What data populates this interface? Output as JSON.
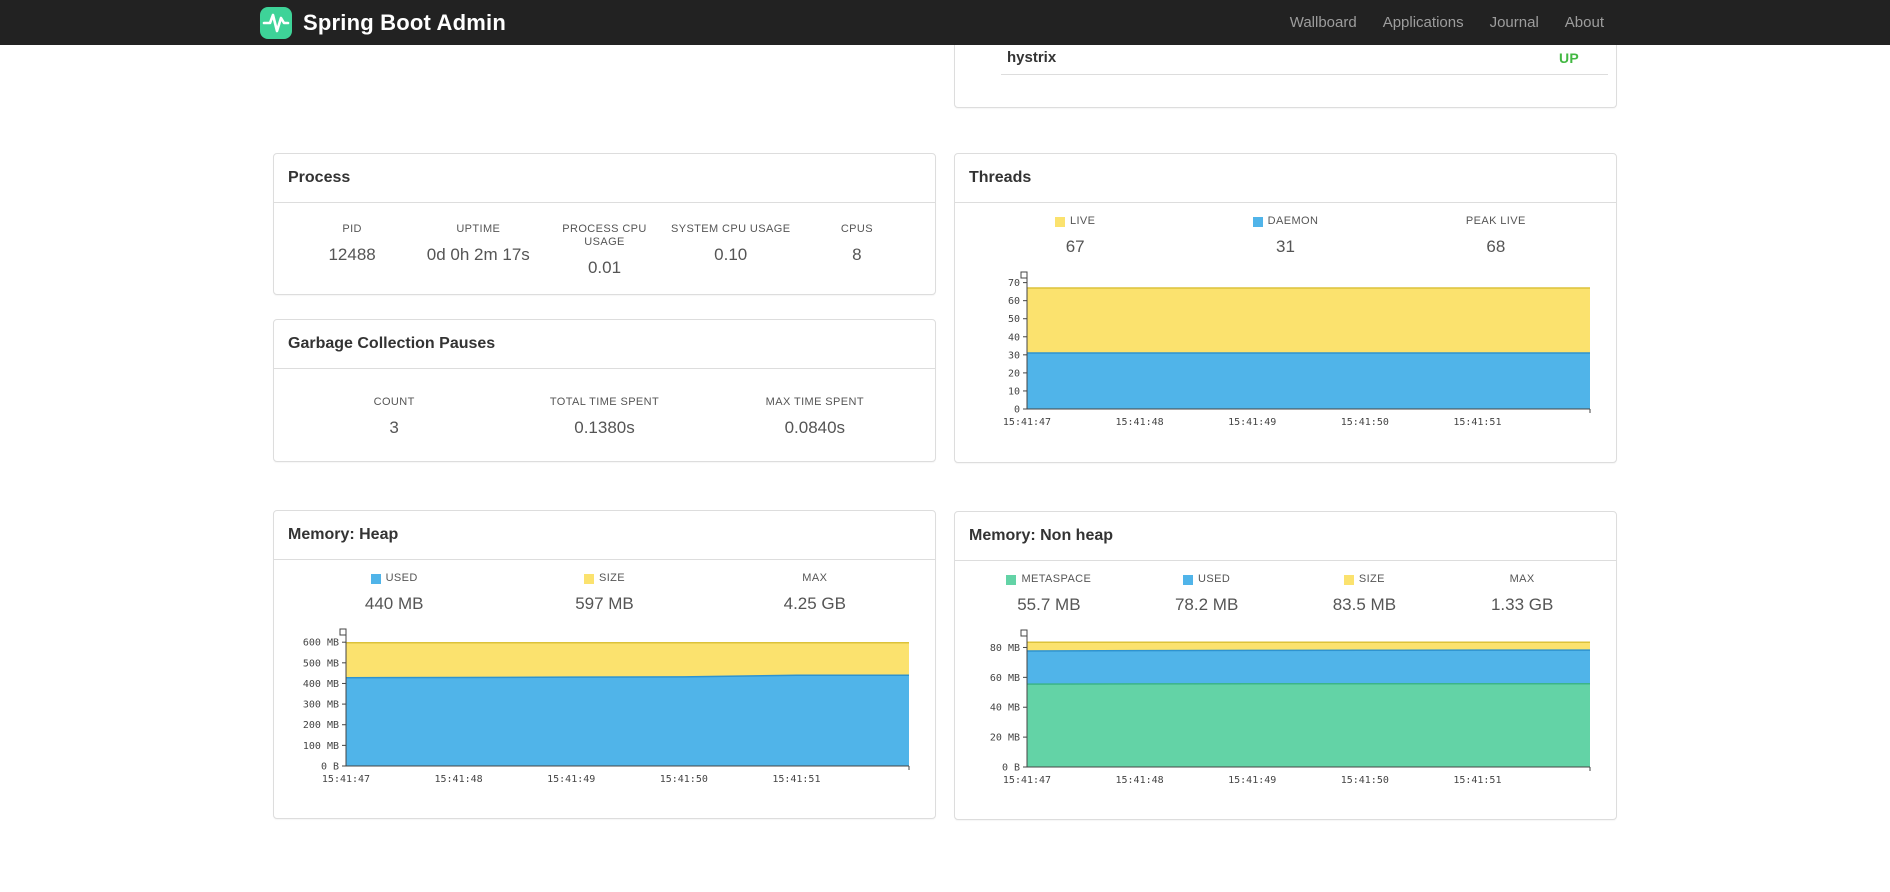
{
  "navbar": {
    "brand": "Spring Boot Admin",
    "links": [
      "Wallboard",
      "Applications",
      "Journal",
      "About"
    ]
  },
  "colors": {
    "blue": "#50b4e9",
    "yellow": "#fbe26e",
    "green": "#63d3a6",
    "status_up": "#43b843",
    "logo": "#3ed398"
  },
  "health": {
    "name": "hystrix",
    "status": "UP"
  },
  "panels": {
    "process": {
      "title": "Process",
      "stats": [
        {
          "label": "PID",
          "value": "12488"
        },
        {
          "label": "UPTIME",
          "value": "0d 0h 2m 17s"
        },
        {
          "label": "PROCESS CPU USAGE",
          "value": "0.01"
        },
        {
          "label": "SYSTEM CPU USAGE",
          "value": "0.10"
        },
        {
          "label": "CPUS",
          "value": "8"
        }
      ]
    },
    "gc": {
      "title": "Garbage Collection Pauses",
      "stats": [
        {
          "label": "COUNT",
          "value": "3"
        },
        {
          "label": "TOTAL TIME SPENT",
          "value": "0.1380s"
        },
        {
          "label": "MAX TIME SPENT",
          "value": "0.0840s"
        }
      ]
    },
    "threads": {
      "title": "Threads",
      "stats": [
        {
          "label": "LIVE",
          "value": "67",
          "swatch": "#fbe26e"
        },
        {
          "label": "DAEMON",
          "value": "31",
          "swatch": "#50b4e9"
        },
        {
          "label": "PEAK LIVE",
          "value": "68"
        }
      ]
    },
    "heap": {
      "title": "Memory: Heap",
      "stats": [
        {
          "label": "USED",
          "value": "440 MB",
          "swatch": "#50b4e9"
        },
        {
          "label": "SIZE",
          "value": "597 MB",
          "swatch": "#fbe26e"
        },
        {
          "label": "MAX",
          "value": "4.25 GB"
        }
      ]
    },
    "nonheap": {
      "title": "Memory: Non heap",
      "stats": [
        {
          "label": "METASPACE",
          "value": "55.7 MB",
          "swatch": "#63d3a6"
        },
        {
          "label": "USED",
          "value": "78.2 MB",
          "swatch": "#50b4e9"
        },
        {
          "label": "SIZE",
          "value": "83.5 MB",
          "swatch": "#fbe26e"
        },
        {
          "label": "MAX",
          "value": "1.33 GB"
        }
      ]
    }
  },
  "chart_data": [
    {
      "id": "threads",
      "type": "area",
      "title": "Threads",
      "x_labels": [
        "15:41:47",
        "15:41:48",
        "15:41:49",
        "15:41:50",
        "15:41:51"
      ],
      "ylim": [
        0,
        72
      ],
      "grid": false,
      "legend_position": "top",
      "yticks": [
        {
          "v": 0,
          "label": "0"
        },
        {
          "v": 10,
          "label": "10"
        },
        {
          "v": 20,
          "label": "20"
        },
        {
          "v": 30,
          "label": "30"
        },
        {
          "v": 40,
          "label": "40"
        },
        {
          "v": 50,
          "label": "50"
        },
        {
          "v": 60,
          "label": "60"
        },
        {
          "v": 70,
          "label": "70"
        }
      ],
      "series": [
        {
          "name": "LIVE",
          "fill": "#fbe26e",
          "stroke": "#dcc23a",
          "values": [
            67,
            67,
            67,
            67,
            67,
            67
          ]
        },
        {
          "name": "DAEMON",
          "fill": "#50b4e9",
          "stroke": "#2e93d0",
          "values": [
            31,
            31,
            31,
            31,
            31,
            31
          ]
        }
      ]
    },
    {
      "id": "heap",
      "type": "area",
      "title": "Memory: Heap",
      "x_labels": [
        "15:41:47",
        "15:41:48",
        "15:41:49",
        "15:41:50",
        "15:41:51"
      ],
      "ylim": [
        0,
        630
      ],
      "grid": false,
      "legend_position": "top",
      "yticks": [
        {
          "v": 0,
          "label": "0 B"
        },
        {
          "v": 100,
          "label": "100 MB"
        },
        {
          "v": 200,
          "label": "200 MB"
        },
        {
          "v": 300,
          "label": "300 MB"
        },
        {
          "v": 400,
          "label": "400 MB"
        },
        {
          "v": 500,
          "label": "500 MB"
        },
        {
          "v": 600,
          "label": "600 MB"
        }
      ],
      "series": [
        {
          "name": "SIZE",
          "fill": "#fbe26e",
          "stroke": "#dcc23a",
          "values": [
            597,
            597,
            597,
            597,
            597,
            597
          ]
        },
        {
          "name": "USED",
          "fill": "#50b4e9",
          "stroke": "#2e93d0",
          "values": [
            428,
            429,
            431,
            432,
            440,
            440
          ]
        }
      ]
    },
    {
      "id": "nonheap",
      "type": "area",
      "title": "Memory: Non heap",
      "x_labels": [
        "15:41:47",
        "15:41:48",
        "15:41:49",
        "15:41:50",
        "15:41:51"
      ],
      "ylim": [
        0,
        87
      ],
      "grid": false,
      "legend_position": "top",
      "yticks": [
        {
          "v": 0,
          "label": "0 B"
        },
        {
          "v": 20,
          "label": "20 MB"
        },
        {
          "v": 40,
          "label": "40 MB"
        },
        {
          "v": 60,
          "label": "60 MB"
        },
        {
          "v": 80,
          "label": "80 MB"
        }
      ],
      "series": [
        {
          "name": "SIZE",
          "fill": "#fbe26e",
          "stroke": "#dcc23a",
          "values": [
            83.5,
            83.5,
            83.5,
            83.5,
            83.5,
            83.5
          ]
        },
        {
          "name": "USED",
          "fill": "#50b4e9",
          "stroke": "#2e93d0",
          "values": [
            77.6,
            77.9,
            78.0,
            78.1,
            78.2,
            78.2
          ]
        },
        {
          "name": "METASPACE",
          "fill": "#63d3a6",
          "stroke": "#3cb488",
          "values": [
            55.5,
            55.6,
            55.7,
            55.7,
            55.7,
            55.7
          ]
        }
      ]
    }
  ]
}
